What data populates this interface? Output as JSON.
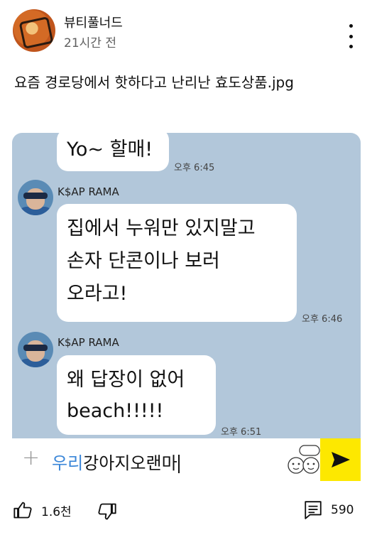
{
  "post": {
    "channel_name": "뷰티풀너드",
    "time_ago": "21시간 전",
    "text": "요즘 경로당에서 핫하다고 난리난 효도상품.jpg"
  },
  "chat": {
    "messages": [
      {
        "text": "Yo~ 할매!",
        "time": "오후 6:45"
      },
      {
        "sender": "K$AP RAMA",
        "text": "집에서 누워만 있지말고\n손자 단콘이나 보러\n오라고!",
        "time": "오후 6:46"
      },
      {
        "sender": "K$AP RAMA",
        "text": "왜 답장이 없어\nbeach!!!!!",
        "time": "오후 6:51"
      }
    ],
    "input": {
      "highlighted": "우리",
      "rest": "강아지오랜마"
    },
    "plus_icon": "plus-icon",
    "send_icon": "send-icon"
  },
  "actions": {
    "like_count": "1.6천",
    "comment_count": "590"
  },
  "colors": {
    "chat_background": "#b2c7da",
    "send_button": "#fde800",
    "input_highlight": "#3a86d8"
  }
}
